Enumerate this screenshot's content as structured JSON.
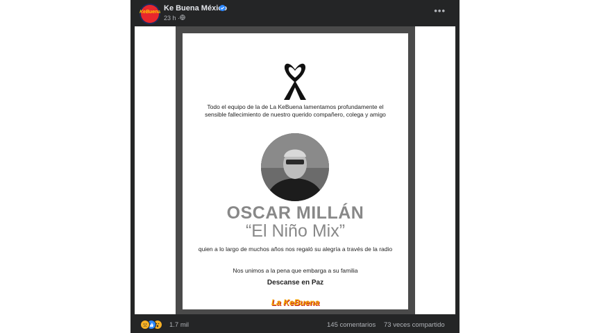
{
  "post": {
    "page_name": "Ke Buena México",
    "time": "23 h",
    "separator": "·",
    "more_icon": "•••",
    "avatar_text": "KeBuena"
  },
  "card": {
    "intro": "Todo el equipo de la de La KeBuena lamentamos profundamente el sensible fallecimiento de nuestro querido compañero, colega y amigo",
    "name": "OSCAR MILLÁN",
    "nickname": "“El Niño Mix”",
    "line1": "quien a lo largo de muchos años nos regaló su alegría a través de la radio",
    "line2": "Nos unimos a la pena que embarga a su familia",
    "rip": "Descanse en Paz",
    "logo": "La KeBuena"
  },
  "footer": {
    "reaction_count": "1.7 mil",
    "comments": "145 comentarios",
    "shares": "73 veces compartido",
    "reactions": [
      "sad",
      "like",
      "wow"
    ]
  },
  "colors": {
    "post_bg": "#242526",
    "text_primary": "#e4e6eb",
    "text_secondary": "#b0b3b8",
    "verified": "#2d88ff",
    "brand_red": "#e8272d",
    "brand_yellow": "#f7a800"
  }
}
